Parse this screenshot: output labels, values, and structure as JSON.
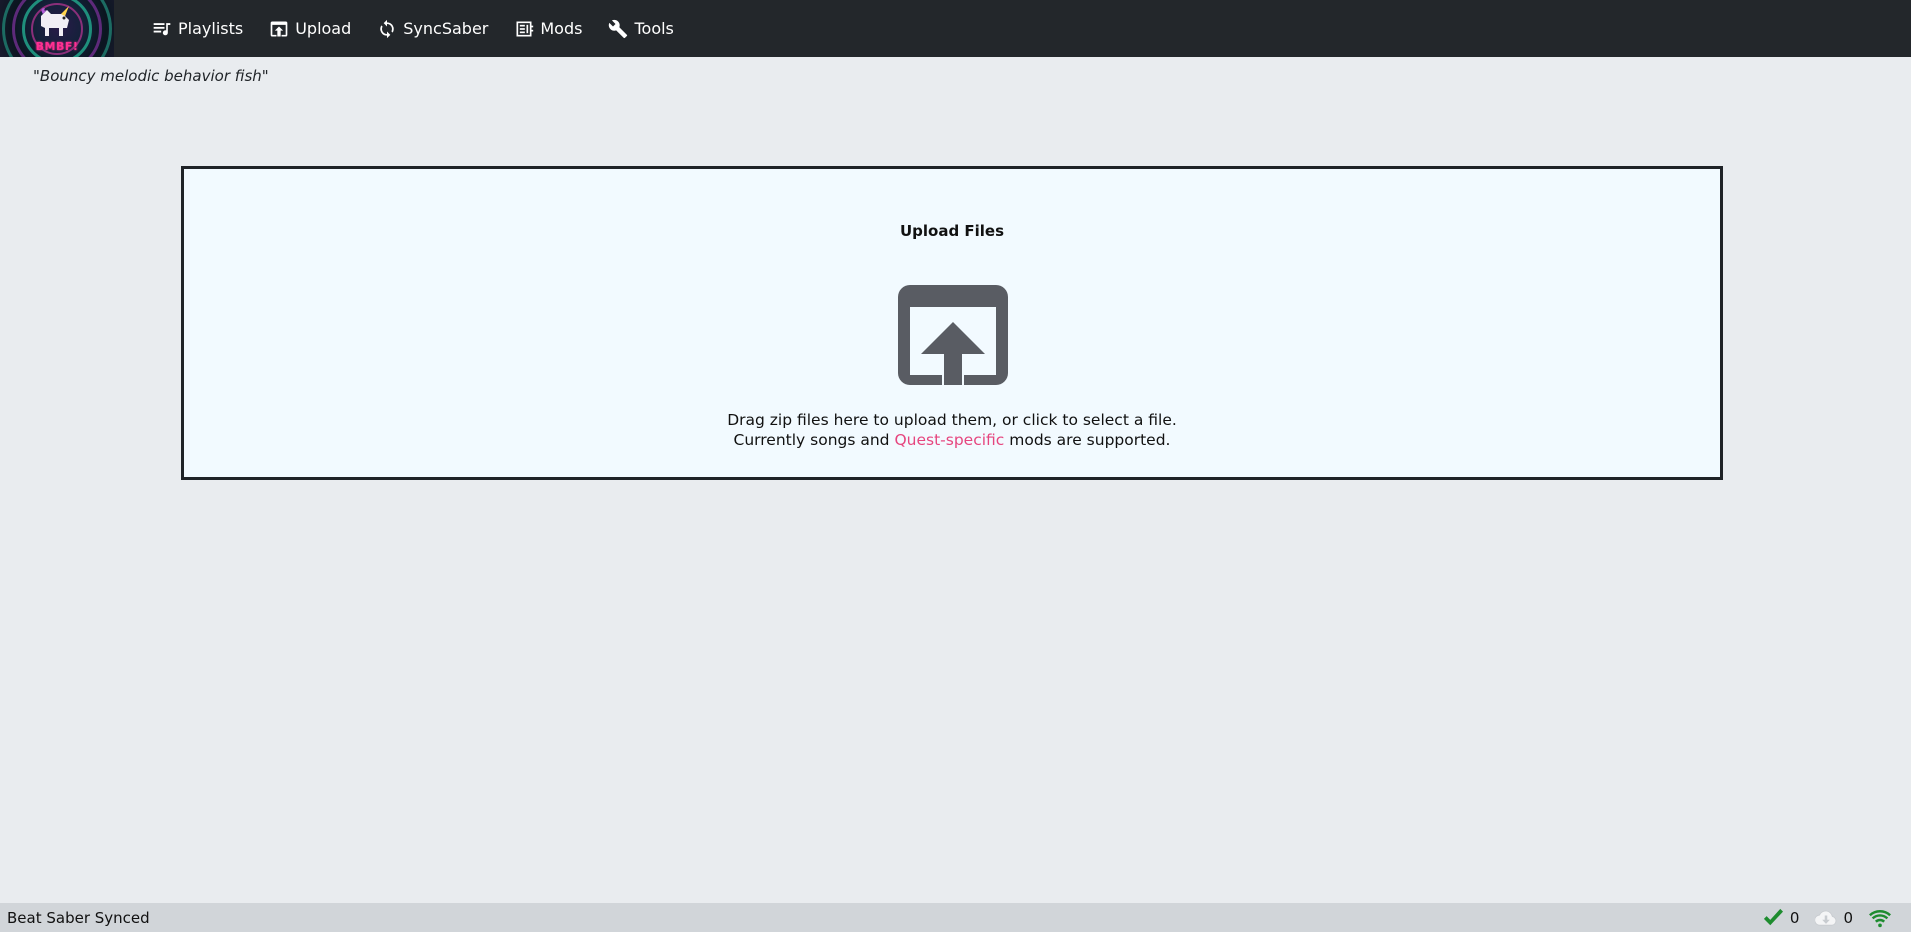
{
  "app": {
    "logo_text": "BMBF!",
    "tagline": "\"Bouncy melodic behavior fish\""
  },
  "nav": {
    "items": [
      {
        "label": "Playlists",
        "icon": "playlist-icon"
      },
      {
        "label": "Upload",
        "icon": "upload-box-icon"
      },
      {
        "label": "SyncSaber",
        "icon": "sync-icon"
      },
      {
        "label": "Mods",
        "icon": "mods-icon"
      },
      {
        "label": "Tools",
        "icon": "wrench-icon"
      }
    ]
  },
  "upload": {
    "title": "Upload Files",
    "icon": "upload-icon",
    "line1": "Drag zip files here to upload them, or click to select a file.",
    "line2_before": "Currently songs and ",
    "line2_link": "Quest-specific",
    "line2_after": " mods are supported."
  },
  "status": {
    "text": "Beat Saber Synced",
    "ok_count": "0",
    "download_count": "0",
    "ok_icon": "checkmark-icon",
    "download_icon": "cloud-download-icon",
    "wifi_icon": "wifi-icon"
  },
  "colors": {
    "navbar_bg": "#23272b",
    "page_bg": "#e9ecef",
    "dropzone_bg": "#f2faff",
    "link": "#e6467f",
    "status_ok": "#1e8c2f"
  }
}
